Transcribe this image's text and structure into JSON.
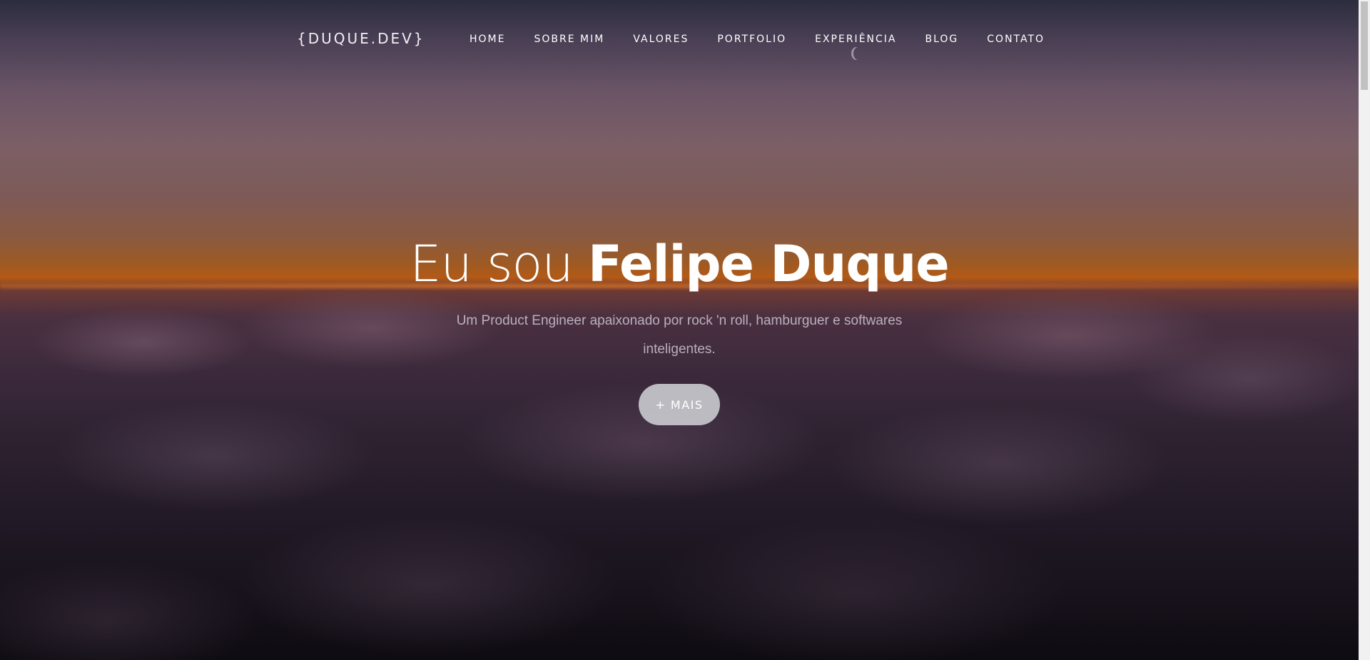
{
  "brand": "{DUQUE.DEV}",
  "nav": {
    "items": [
      {
        "label": "HOME"
      },
      {
        "label": "SOBRE MIM"
      },
      {
        "label": "VALORES"
      },
      {
        "label": "PORTFOLIO"
      },
      {
        "label": "EXPERIÊNCIA"
      },
      {
        "label": "BLOG"
      },
      {
        "label": "CONTATO"
      }
    ]
  },
  "hero": {
    "title_prefix": "Eu sou ",
    "title_name": "Felipe Duque",
    "subtitle": "Um Product Engineer apaixonado por rock 'n roll, hamburguer e softwares inteligentes.",
    "cta_label": "+ MAIS"
  },
  "icons": {
    "moon": "moon-icon"
  },
  "colors": {
    "text": "#ffffff",
    "button_bg": "#c8c8cd"
  }
}
